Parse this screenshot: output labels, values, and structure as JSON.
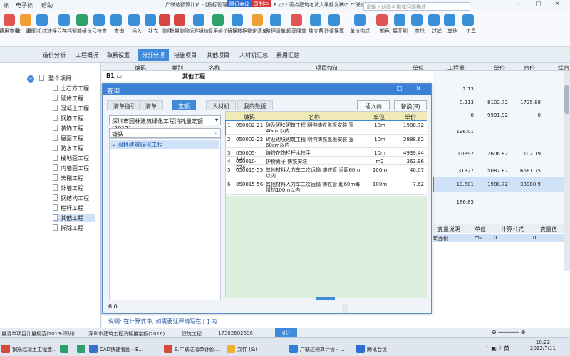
{
  "app": {
    "menu": [
      "标",
      "电子标",
      "帮助"
    ],
    "title": "广联达预算计价 - [投标管理 - 超高层-提升图纸 - E:\\\\! ! 奇点建筑考试大录播发稿\\5.广联达云计价GCCP6.0\\超高层-提升图纸.GBQ6]",
    "meeting_badge": "腾讯会议",
    "rec_badge": "录制中",
    "search_placeholder": "请输入功能名称或问题描述",
    "window_buttons": "— ▢ ✕",
    "colors": {
      "accent": "#3f8ad9",
      "dialog_title": "#3b82d6",
      "highlight_row": "#cfe2f8"
    }
  },
  "ribbon": [
    {
      "label": "费用查看",
      "color": "#e05454",
      "icon": "cost-view-icon"
    },
    {
      "label": "统一调价",
      "color": "#f0a030",
      "icon": "price-adjust-icon"
    },
    {
      "label": "新旧机械转换",
      "color": "#3a8fd9",
      "icon": "machine-convert-icon"
    },
    {
      "label": "云存档",
      "color": "#3a8fd9",
      "icon": "cloud-save-icon"
    },
    {
      "label": "智能组价",
      "color": "#2ea06a",
      "icon": "smart-price-icon"
    },
    {
      "label": "云检查",
      "color": "#3a8fd9",
      "icon": "cloud-check-icon"
    },
    {
      "label": "查询",
      "color": "#3a8fd9",
      "icon": "query-icon"
    },
    {
      "label": "插入",
      "color": "#3a8fd9",
      "icon": "insert-icon"
    },
    {
      "label": "补充",
      "color": "#3a8fd9",
      "icon": "supplement-icon"
    },
    {
      "label": "删除",
      "color": "#d84444",
      "icon": "delete-icon"
    },
    {
      "label": "批量删除",
      "color": "#d84444",
      "icon": "batch-delete-icon"
    },
    {
      "label": "标准组价",
      "color": "#3a8fd9",
      "icon": "standard-price-icon"
    },
    {
      "label": "复用组价",
      "color": "#2ea06a",
      "icon": "reuse-price-icon"
    },
    {
      "label": "替换数据",
      "color": "#3a8fd9",
      "icon": "replace-data-icon"
    },
    {
      "label": "锁定清单",
      "color": "#f0a030",
      "icon": "lock-list-icon"
    },
    {
      "label": "整理清单",
      "color": "#3a8fd9",
      "icon": "organize-list-icon"
    },
    {
      "label": "超高降效",
      "color": "#e05454",
      "icon": "high-efficiency-icon"
    },
    {
      "label": "独立费",
      "color": "#3a8fd9",
      "icon": "independent-fee-icon"
    },
    {
      "label": "砂浆换算",
      "color": "#3a8fd9",
      "icon": "mortar-convert-icon"
    },
    {
      "label": "单价构成",
      "color": "#3a8fd9",
      "icon": "unit-price-icon"
    },
    {
      "label": "颜色",
      "color": "#e05454",
      "icon": "color-icon"
    },
    {
      "label": "展开到",
      "color": "#3a8fd9",
      "icon": "expand-icon"
    },
    {
      "label": "查找",
      "color": "#3a8fd9",
      "icon": "find-icon"
    },
    {
      "label": "过滤",
      "color": "#3a8fd9",
      "icon": "filter-icon"
    },
    {
      "label": "其他",
      "color": "#3a8fd9",
      "icon": "other-icon"
    },
    {
      "label": "工具",
      "color": "#3a8fd9",
      "icon": "tools-icon"
    }
  ],
  "tabs": [
    "造价分析",
    "工程概况",
    "取费设置",
    "分部分项",
    "措施项目",
    "其他项目",
    "人材机汇总",
    "费用汇总"
  ],
  "active_tab": "分部分项",
  "tree": {
    "root": "整个项目",
    "items": [
      "土石方工程",
      "砌体工程",
      "混凝土工程",
      "钢筋工程",
      "装饰工程",
      "屋面工程",
      "防水工程",
      "楼地面工程",
      "内墙面工程",
      "天棚工程",
      "外墙工程",
      "钢结构工程",
      "栏杆工程",
      "其他工程",
      "拆除工程"
    ],
    "selected": "其他工程"
  },
  "grid": {
    "headers": [
      "编码",
      "类别",
      "名称",
      "项目特征",
      "单位",
      "工程量",
      "单价",
      "合价",
      "综合"
    ],
    "section": "其他工程",
    "rows": [
      {
        "qty": "2.13",
        "price": "",
        "total": ""
      },
      {
        "qty": "0.213",
        "price": "8102.72",
        "total": "1725.88"
      },
      {
        "qty": "0",
        "price": "9991.92",
        "total": "0"
      },
      {
        "qty": "196.01",
        "price": "",
        "total": ""
      },
      {
        "qty": "0.0392",
        "price": "2606.82",
        "total": "102.19"
      },
      {
        "qty": "1.31327",
        "price": "5087.87",
        "total": "6681.75"
      },
      {
        "qty": "19.601",
        "price": "1988.72",
        "total": "38980.9"
      },
      {
        "qty": "186.85",
        "price": "",
        "total": ""
      }
    ],
    "var_headers": [
      "变量说明",
      "单位",
      "计算公式",
      "变量值"
    ],
    "var_row": [
      "筑面积",
      "m2",
      "0",
      "0"
    ]
  },
  "dialog": {
    "title": "查询",
    "tabs": [
      "清单指引",
      "清单",
      "定额",
      "人材机",
      "我的数据"
    ],
    "active_tab": "定额",
    "insert_button": "插入(I)",
    "replace_button": "替换(R)",
    "quota_select": "深圳市园林建筑绿化工程消耗量定额(2017)",
    "search_value": "铸铁",
    "tree_item": "园林建筑绿化工程",
    "table_headers": [
      "编码",
      "名称",
      "单位",
      "单价"
    ],
    "rows": [
      {
        "no": "1",
        "code": "050002-21",
        "name": "砖及砌块砌筑工程 明沟铸铁盖板安装 宽40cm以内",
        "unit": "10m",
        "price": "1988.72"
      },
      {
        "no": "2",
        "code": "050002-22",
        "name": "砖及砌块砌筑工程 明沟铸铁盖板安装 宽60cm以内",
        "unit": "10m",
        "price": "2988.62"
      },
      {
        "no": "3",
        "code": "050005-123",
        "name": "铸铁花饰栏杆木扶手",
        "unit": "10m",
        "price": "4939.44"
      },
      {
        "no": "4",
        "code": "050010-274",
        "name": "护树篱子 铸铁安装",
        "unit": "m2",
        "price": "363.96"
      },
      {
        "no": "5",
        "code": "050015-55",
        "name": "其他材料人力车二次运输 铸铁管 运距60m以内",
        "unit": "100m",
        "price": "40.07"
      },
      {
        "no": "6",
        "code": "050015-56",
        "name": "其他材料人力车二次运输 铸铁管 超60m每增加100m以内",
        "unit": "100m",
        "price": "7.62"
      }
    ],
    "footnote": "说明: 在计算式中, 如需要注释请写在 [ ] 内."
  },
  "statusbar": [
    "量清单项目计量规范(2013-深圳)",
    "深圳市建筑工程消耗量定额(2016)",
    "建筑工程",
    "17302682696",
    "0分"
  ],
  "taskbar": [
    {
      "label": "钢筋混凝土工程造...",
      "color": "#d24a3a"
    },
    {
      "label": "",
      "color": "#2ea06a"
    },
    {
      "label": "CAD快速看图 - E...",
      "color": "#3a6fd0"
    },
    {
      "label": "9.广联达清单计价...",
      "color": "#d24a3a"
    },
    {
      "label": "文件 (E:)",
      "color": "#f0b030"
    },
    {
      "label": "广联达预算计价 - ...",
      "color": "#2f7ed8"
    },
    {
      "label": "腾讯会议",
      "color": "#2c6ed5"
    }
  ],
  "clock": {
    "time": "18:22",
    "date": "2022/7/11"
  }
}
